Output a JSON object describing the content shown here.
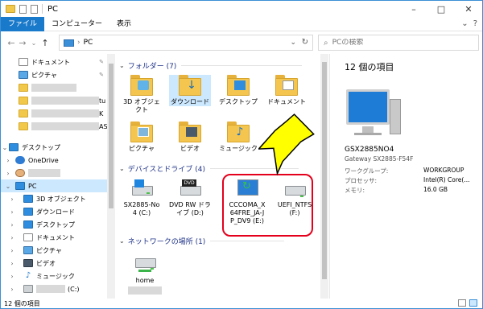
{
  "window": {
    "title": "PC",
    "controls": [
      "–",
      "□",
      "✕"
    ]
  },
  "ribbon": {
    "tabs": [
      "ファイル",
      "コンピューター",
      "表示"
    ],
    "expand": "⌄",
    "help": "?"
  },
  "address": {
    "back": "←",
    "forward": "→",
    "history": "⌄",
    "up": "↑",
    "path": "PC",
    "path_arrow": "›",
    "dropdown": "⌄",
    "refresh": "↻",
    "search_placeholder": "PCの検索",
    "search_icon": "⌕"
  },
  "nav": {
    "items": [
      {
        "label": "ドキュメント",
        "pinned": true
      },
      {
        "label": "ピクチャ",
        "pinned": true
      },
      {
        "label": ""
      },
      {
        "label": "",
        "suffix": "tu"
      },
      {
        "label": "",
        "suffix": "K"
      },
      {
        "label": "",
        "suffix": "AS"
      },
      {
        "label": "デスクトップ"
      },
      {
        "label": "OneDrive"
      },
      {
        "label": ""
      },
      {
        "label": "PC"
      },
      {
        "label": "3D オブジェクト"
      },
      {
        "label": "ダウンロード"
      },
      {
        "label": "デスクトップ"
      },
      {
        "label": "ドキュメント"
      },
      {
        "label": "ピクチャ"
      },
      {
        "label": "ビデオ"
      },
      {
        "label": "ミュージック"
      },
      {
        "label": "(C:)"
      }
    ]
  },
  "main": {
    "folders_header": "フォルダー (7)",
    "folders": [
      {
        "label": "3D オブジェクト",
        "icon": "3d-objects-folder-icon"
      },
      {
        "label": "ダウンロード",
        "icon": "downloads-folder-icon"
      },
      {
        "label": "デスクトップ",
        "icon": "desktop-folder-icon"
      },
      {
        "label": "ドキュメント",
        "icon": "documents-folder-icon"
      },
      {
        "label": "ピクチャ",
        "icon": "pictures-folder-icon"
      },
      {
        "label": "ビデオ",
        "icon": "videos-folder-icon"
      },
      {
        "label": "ミュージック",
        "icon": "music-folder-icon"
      }
    ],
    "devices_header": "デバイスとドライブ (4)",
    "drives": [
      {
        "label": "SX2885-No 4 (C:)",
        "icon": "windows-drive-icon"
      },
      {
        "label": "DVD RW ドライブ (D:)",
        "icon": "dvd-drive-icon"
      },
      {
        "label": "CCCOMA_X 64FRE_JA-J P_DV9 (E:)",
        "icon": "install-media-drive-icon"
      },
      {
        "label": "UEFI_NTFS (F:)",
        "icon": "usb-drive-icon"
      }
    ],
    "network_header": "ネットワークの場所 (1)",
    "network": [
      {
        "label": "home",
        "icon": "network-drive-icon"
      }
    ]
  },
  "details": {
    "count": "12 個の項目",
    "name": "GSX2885NO4",
    "model": "Gateway SX2885-F54F",
    "rows": [
      {
        "k": "ワークグループ:",
        "v": "WORKGROUP"
      },
      {
        "k": "プロセッサ:",
        "v": "Intel(R) Core(..."
      },
      {
        "k": "メモリ:",
        "v": "16.0 GB"
      }
    ]
  },
  "status": {
    "text": "12 個の項目"
  },
  "colors": {
    "accent": "#1979ca",
    "selection": "#cce8ff",
    "callout": "#e4001c",
    "arrow": "#ffff00"
  }
}
